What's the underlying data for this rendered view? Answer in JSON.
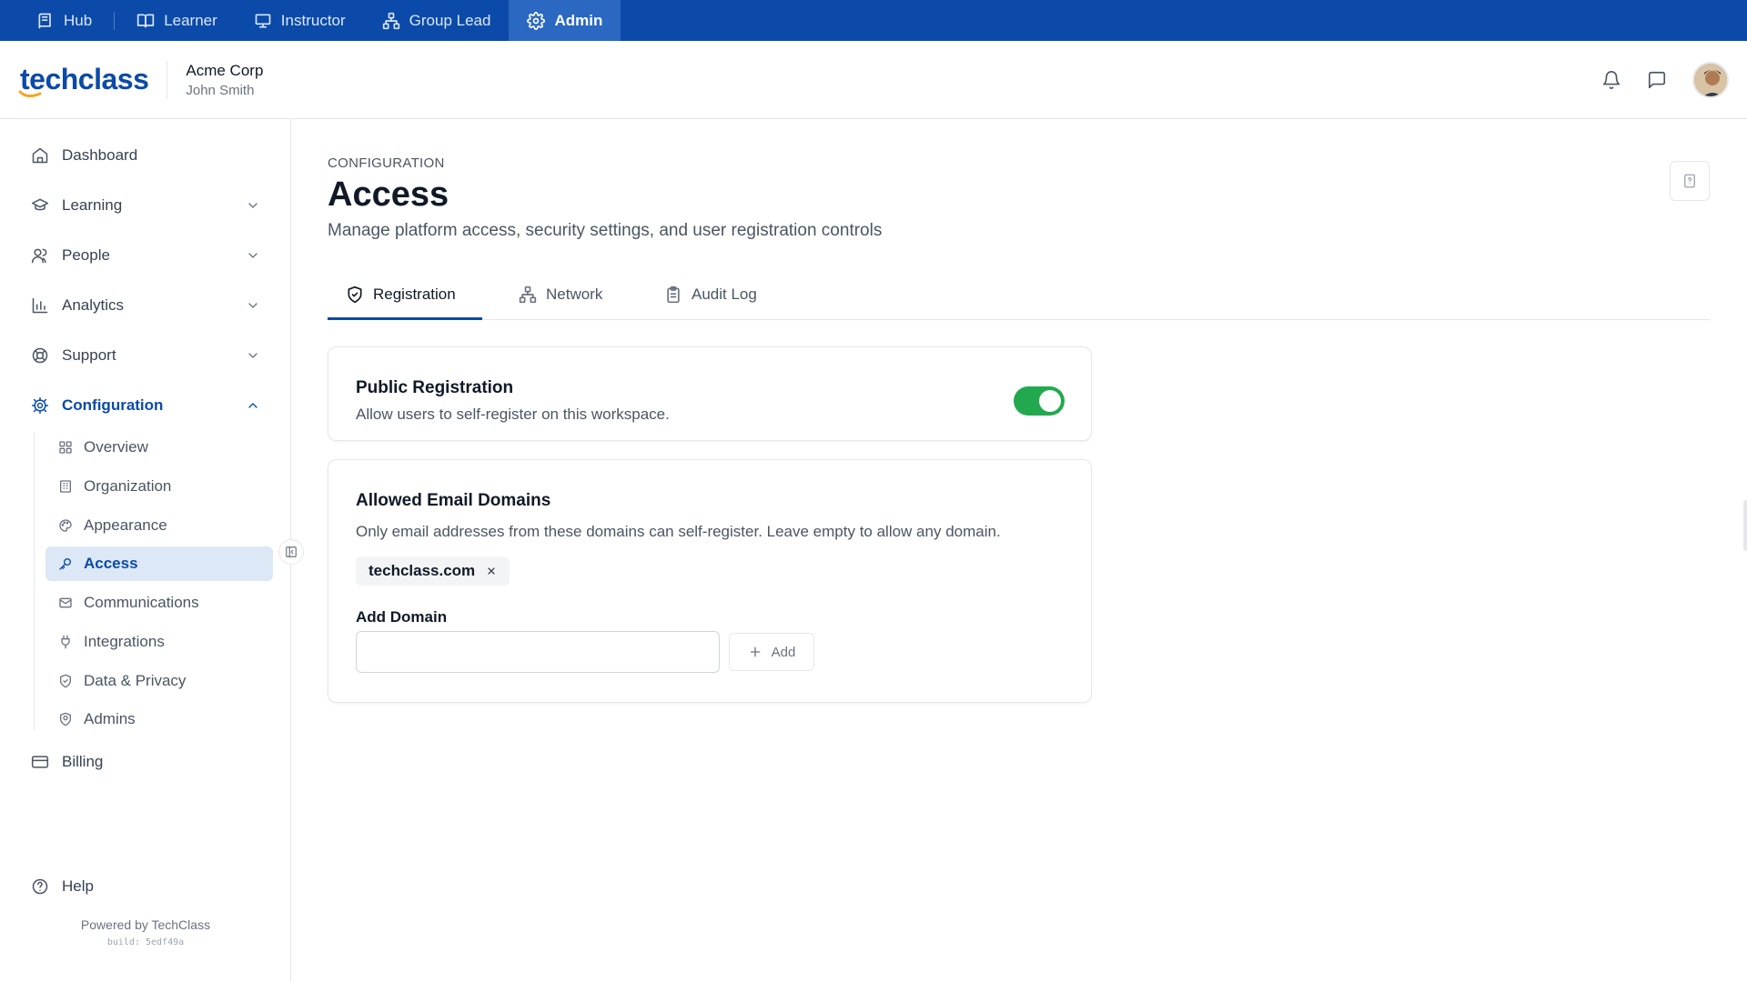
{
  "roles": [
    {
      "label": "Hub",
      "icon": "book-stack-icon"
    },
    {
      "label": "Learner",
      "icon": "book-open-icon"
    },
    {
      "label": "Instructor",
      "icon": "presentation-icon"
    },
    {
      "label": "Group Lead",
      "icon": "org-chart-icon"
    },
    {
      "label": "Admin",
      "icon": "gear-icon",
      "active": true
    }
  ],
  "header": {
    "logo_text": "techclass",
    "org_name": "Acme Corp",
    "user_name": "John Smith"
  },
  "sidebar": {
    "items": [
      {
        "label": "Dashboard",
        "icon": "home-icon"
      },
      {
        "label": "Learning",
        "icon": "graduation-cap-icon",
        "expandable": true
      },
      {
        "label": "People",
        "icon": "users-icon",
        "expandable": true
      },
      {
        "label": "Analytics",
        "icon": "bar-chart-icon",
        "expandable": true
      },
      {
        "label": "Support",
        "icon": "lifebuoy-icon",
        "expandable": true
      },
      {
        "label": "Configuration",
        "icon": "gear-icon",
        "expandable": true,
        "open": true
      }
    ],
    "config_items": [
      {
        "label": "Overview",
        "icon": "grid-icon"
      },
      {
        "label": "Organization",
        "icon": "building-icon"
      },
      {
        "label": "Appearance",
        "icon": "palette-icon"
      },
      {
        "label": "Access",
        "icon": "key-icon",
        "active": true
      },
      {
        "label": "Communications",
        "icon": "mail-icon"
      },
      {
        "label": "Integrations",
        "icon": "plug-icon"
      },
      {
        "label": "Data & Privacy",
        "icon": "shield-check-icon"
      },
      {
        "label": "Admins",
        "icon": "shield-user-icon"
      }
    ],
    "billing_label": "Billing",
    "help_label": "Help",
    "powered_by": "Powered by TechClass",
    "build": "build: 5edf49a"
  },
  "page": {
    "eyebrow": "CONFIGURATION",
    "title": "Access",
    "subtitle": "Manage platform access, security settings, and user registration controls"
  },
  "tabs": [
    {
      "label": "Registration",
      "icon": "shield-check-icon",
      "active": true
    },
    {
      "label": "Network",
      "icon": "network-icon"
    },
    {
      "label": "Audit Log",
      "icon": "clipboard-icon"
    }
  ],
  "public_registration": {
    "title": "Public Registration",
    "description": "Allow users to self-register on this workspace.",
    "enabled": true,
    "toggle_color": "#22a94f"
  },
  "allowed_domains": {
    "title": "Allowed Email Domains",
    "description": "Only email addresses from these domains can self-register. Leave empty to allow any domain.",
    "domains": [
      "techclass.com"
    ],
    "add_label": "Add Domain",
    "input_value": "",
    "add_button": "Add"
  },
  "colors": {
    "brand": "#0b4aa8",
    "active_bg": "#dde8f6",
    "success": "#22a94f"
  }
}
